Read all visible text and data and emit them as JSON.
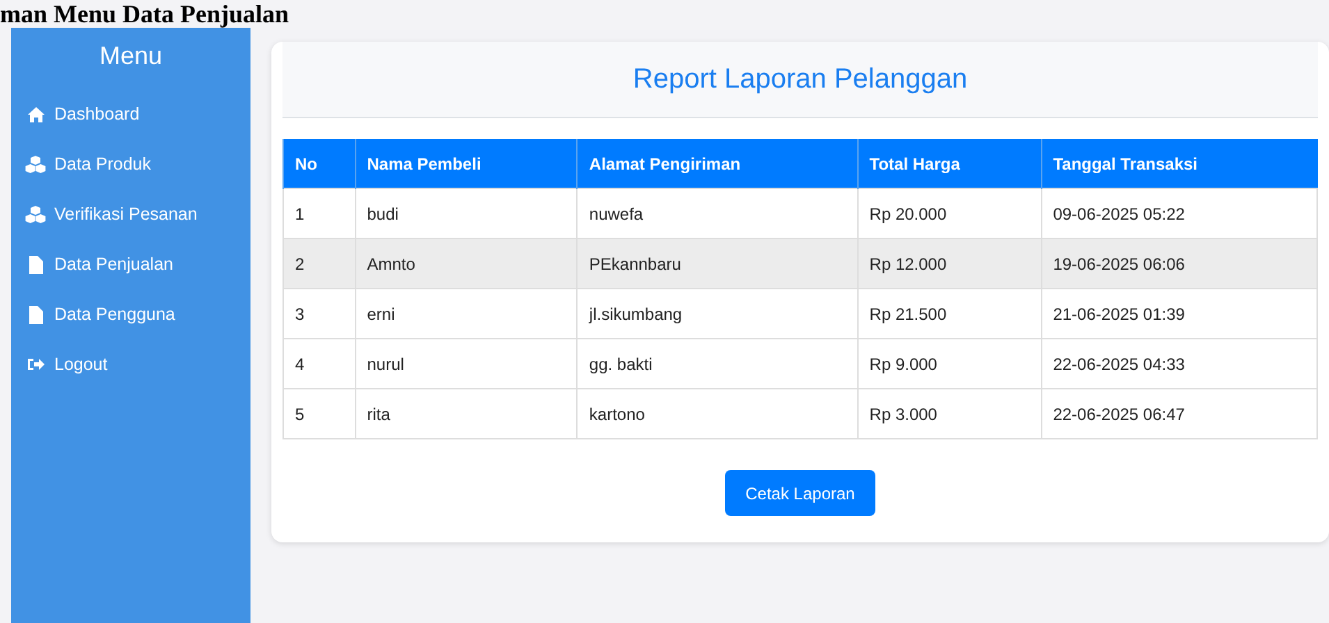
{
  "page_heading": "man Menu Data Penjualan",
  "sidebar": {
    "title": "Menu",
    "items": [
      {
        "label": "Dashboard",
        "kind": "home"
      },
      {
        "label": "Data Produk",
        "kind": "cubes"
      },
      {
        "label": "Verifikasi Pesanan",
        "kind": "cubes"
      },
      {
        "label": "Data Penjualan",
        "kind": "file"
      },
      {
        "label": "Data Pengguna",
        "kind": "file"
      },
      {
        "label": "Logout",
        "kind": "exit"
      }
    ]
  },
  "report": {
    "title": "Report Laporan Pelanggan",
    "table": {
      "columns": [
        "No",
        "Nama Pembeli",
        "Alamat Pengiriman",
        "Total Harga",
        "Tanggal Transaksi"
      ],
      "rows": [
        {
          "cells": [
            "1",
            "budi",
            "nuwefa",
            "Rp 20.000",
            "09-06-2025 05:22"
          ],
          "highlighted": false
        },
        {
          "cells": [
            "2",
            "Amnto",
            "PEkannbaru",
            "Rp 12.000",
            "19-06-2025 06:06"
          ],
          "highlighted": true
        },
        {
          "cells": [
            "3",
            "erni",
            "jl.sikumbang",
            "Rp 21.500",
            "21-06-2025 01:39"
          ],
          "highlighted": false
        },
        {
          "cells": [
            "4",
            "nurul",
            "gg. bakti",
            "Rp 9.000",
            "22-06-2025 04:33"
          ],
          "highlighted": false
        },
        {
          "cells": [
            "5",
            "rita",
            "kartono",
            "Rp 3.000",
            "22-06-2025 06:47"
          ],
          "highlighted": false
        }
      ]
    },
    "button": "Cetak Laporan"
  }
}
